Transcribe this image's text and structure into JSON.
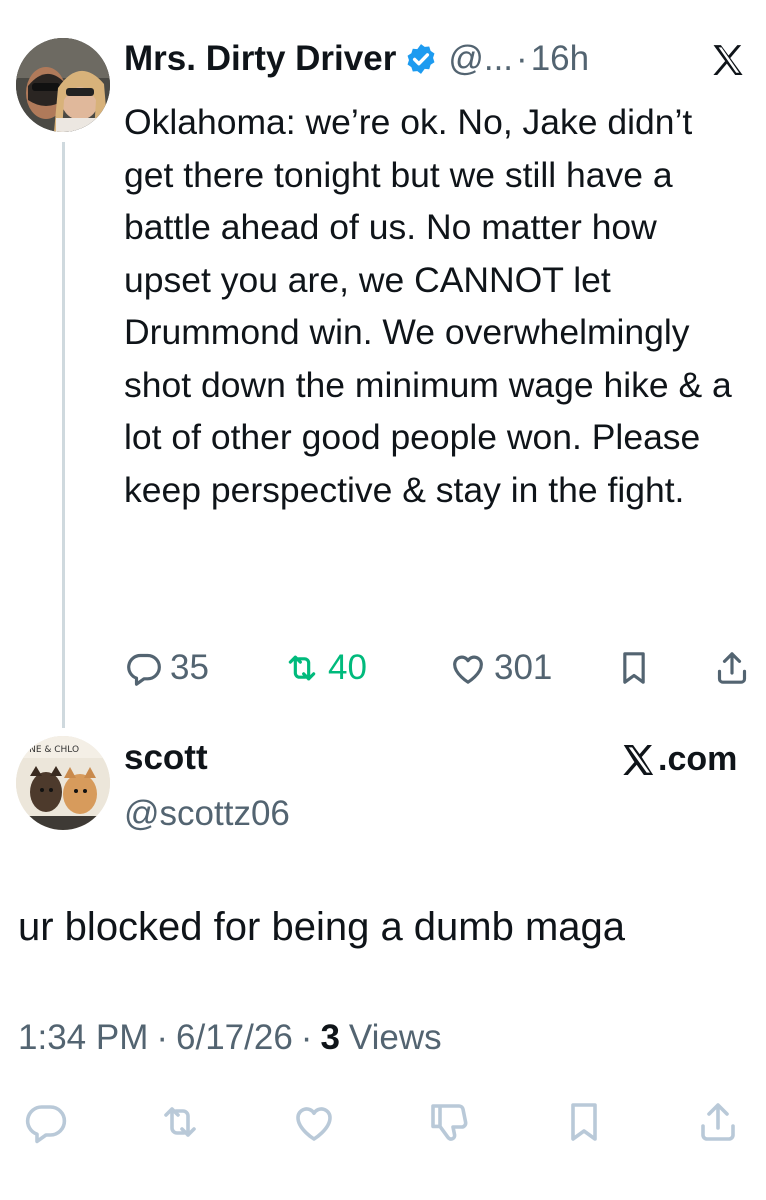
{
  "original_tweet": {
    "display_name": "Mrs. Dirty Driver",
    "handle": "@...",
    "separator": "·",
    "time_ago": "16h",
    "text": "Oklahoma: we’re ok. No, Jake didn’t get there tonight but we still have a battle ahead of us. No matter how upset you are, we CANNOT let Drummond win. We overwhelmingly shot down the minimum wage hike & a lot of other good people won. Please keep perspective & stay in the fight.",
    "replies": "35",
    "retweets": "40",
    "likes": "301",
    "icons": [
      "verified-badge-icon",
      "x-logo-icon",
      "reply-icon",
      "retweet-icon",
      "like-icon",
      "bookmark-icon",
      "share-icon"
    ]
  },
  "reply_card": {
    "display_name": "scott",
    "handle": "@scottz06",
    "brand": ".com",
    "avatar_text": "ONE & CHLO",
    "text": "ur blocked for being a dumb maga",
    "time": "1:34 PM",
    "date": "6/17/26",
    "separator": "·",
    "views_count": "3",
    "views_label": "Views"
  },
  "colors": {
    "text": "#0f1419",
    "muted": "#536471",
    "verified": "#1d9bf0",
    "retweet": "#00ba7c",
    "inactive_icons": "#b9c9d8",
    "thread_line": "#cfd9de"
  }
}
